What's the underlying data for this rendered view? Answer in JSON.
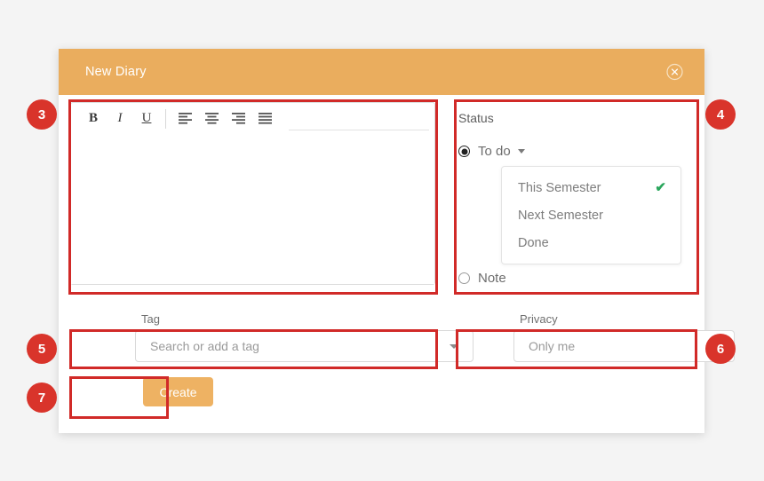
{
  "modal": {
    "title": "New Diary",
    "close_icon": "close-circle-icon"
  },
  "editor": {
    "toolbar": [
      {
        "name": "bold-button",
        "glyph": "B"
      },
      {
        "name": "italic-button",
        "glyph": "I"
      },
      {
        "name": "underline-button",
        "glyph": "U"
      },
      {
        "name": "align-left-button",
        "glyph": "align-left-icon"
      },
      {
        "name": "align-center-button",
        "glyph": "align-center-icon"
      },
      {
        "name": "align-right-button",
        "glyph": "align-right-icon"
      },
      {
        "name": "align-justify-button",
        "glyph": "align-justify-icon"
      }
    ],
    "bold_label": "B",
    "italic_label": "I",
    "underline_label": "U",
    "content": ""
  },
  "status": {
    "label": "Status",
    "options": [
      {
        "label": "To do",
        "selected": true,
        "has_caret": true
      },
      {
        "label": "Note",
        "selected": false,
        "has_caret": false
      }
    ],
    "todo_label": "To do",
    "note_label": "Note",
    "menu": {
      "items": [
        {
          "label": "This Semester",
          "checked": true
        },
        {
          "label": "Next Semester",
          "checked": false
        },
        {
          "label": "Done",
          "checked": false
        }
      ],
      "check_glyph": "✔",
      "check_color": "#2aa65c"
    }
  },
  "tag": {
    "label": "Tag",
    "placeholder": "Search or add a tag",
    "value": ""
  },
  "privacy": {
    "label": "Privacy",
    "value": "Only me",
    "options": [
      "Only me"
    ]
  },
  "actions": {
    "create_label": "Create"
  },
  "annotations": [
    {
      "number": "3",
      "target": "editor"
    },
    {
      "number": "4",
      "target": "status"
    },
    {
      "number": "5",
      "target": "tag"
    },
    {
      "number": "6",
      "target": "privacy"
    },
    {
      "number": "7",
      "target": "create-button"
    }
  ],
  "colors": {
    "header": "#eaad5e",
    "primary_button": "#eeb263",
    "annotation_red": "#d12a28",
    "badge_red": "#d9342b",
    "page_background": "#f4f4f4",
    "check_green": "#2aa65c"
  }
}
